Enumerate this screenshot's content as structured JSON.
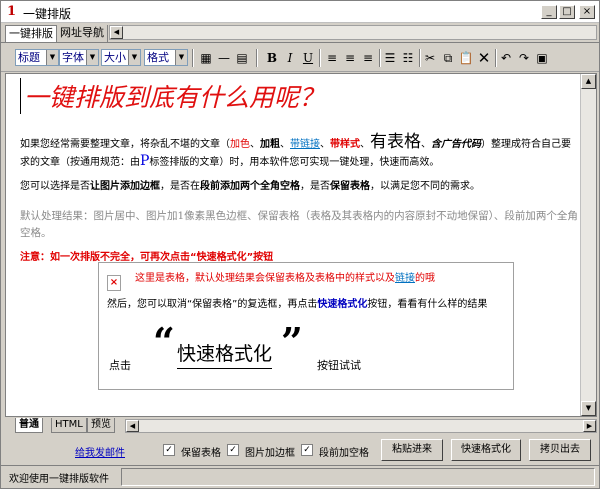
{
  "window": {
    "title": "一键排版",
    "app_icon_glyph": "1",
    "controls": {
      "minimize": "_",
      "maximize": "□",
      "close": "×"
    }
  },
  "top_tabs": [
    {
      "label": "一键排版",
      "active": true
    },
    {
      "label": "网址导航",
      "active": false
    }
  ],
  "toolbar": {
    "selects": [
      "标题",
      "字体",
      "大小",
      "格式"
    ],
    "icons": [
      "image-icon",
      "hr-icon",
      "table-icon",
      "bold-icon",
      "italic-icon",
      "underline-icon",
      "align-left-icon",
      "align-center-icon",
      "align-right-icon",
      "ordered-list-icon",
      "unordered-list-icon",
      "cut-icon",
      "copy-icon",
      "paste-icon",
      "delete-icon",
      "undo-icon",
      "redo-icon",
      "properties-icon"
    ],
    "bold_glyph": "B",
    "italic_glyph": "I",
    "underline_glyph": "U"
  },
  "document": {
    "title": "一键排版到底有什么用呢？",
    "para1": {
      "t1": "如果您经常需要整理文章，将杂乱不堪的文章（",
      "add_color": "加色",
      "sep1": "、",
      "add_bold": "加粗",
      "sep2": "、",
      "with_link": "带链接",
      "sep3": "、",
      "with_style": "带样式",
      "sep4": "、",
      "with_table": "有表格",
      "sep5": "、",
      "with_code": "含广告代码",
      "t2": "）整理成符合自己要求的文章（按通用规范：由",
      "p_tag": "P",
      "t3": "标签排版的文章）时，用本软件您可实现一键处理，快速而高效。"
    },
    "para2": {
      "t1": "您可以选择是否",
      "b1": "让图片添加边框",
      "t2": "，是否在",
      "b2": "段前添加两个全角空格",
      "t3": "，是否",
      "b3": "保留表格",
      "t4": "，以满足您不同的需求。"
    },
    "para3": "默认处理结果：图片居中、图片加1像素黑色边框、保留表格（表格及其表格内的内容原封不动地保留）、段前加两个全角空格。",
    "note": "注意：如一次排版不完全，可再次点击“快速格式化”按钮",
    "embed": {
      "line1": "这里是表格，默认处理结果会保留表格及表格中的样式以及",
      "line1_link": "链接",
      "line1_end": "的哦",
      "line2_t1": "然后，您可以取消“保留表格”的复选框，再点击",
      "line2_bold": "快速格式化",
      "line2_t2": "按钮，看看有什么样的结果",
      "click_a": "点击",
      "quote_left": "“",
      "format_text": "快速格式化",
      "quote_right": "”",
      "click_b": "按钮试试"
    }
  },
  "bottom_tabs": [
    {
      "label": "普通",
      "active": true
    },
    {
      "label": "HTML",
      "active": false
    },
    {
      "label": "预览",
      "active": false
    }
  ],
  "actions": {
    "mail_link": "给我发邮件",
    "checkboxes": [
      {
        "label": "保留表格",
        "checked": true
      },
      {
        "label": "图片加边框",
        "checked": true
      },
      {
        "label": "段前加空格",
        "checked": true
      }
    ],
    "buttons": [
      "粘贴进来",
      "快速格式化",
      "拷贝出去"
    ]
  },
  "status": {
    "text": "欢迎使用一键排版软件"
  }
}
